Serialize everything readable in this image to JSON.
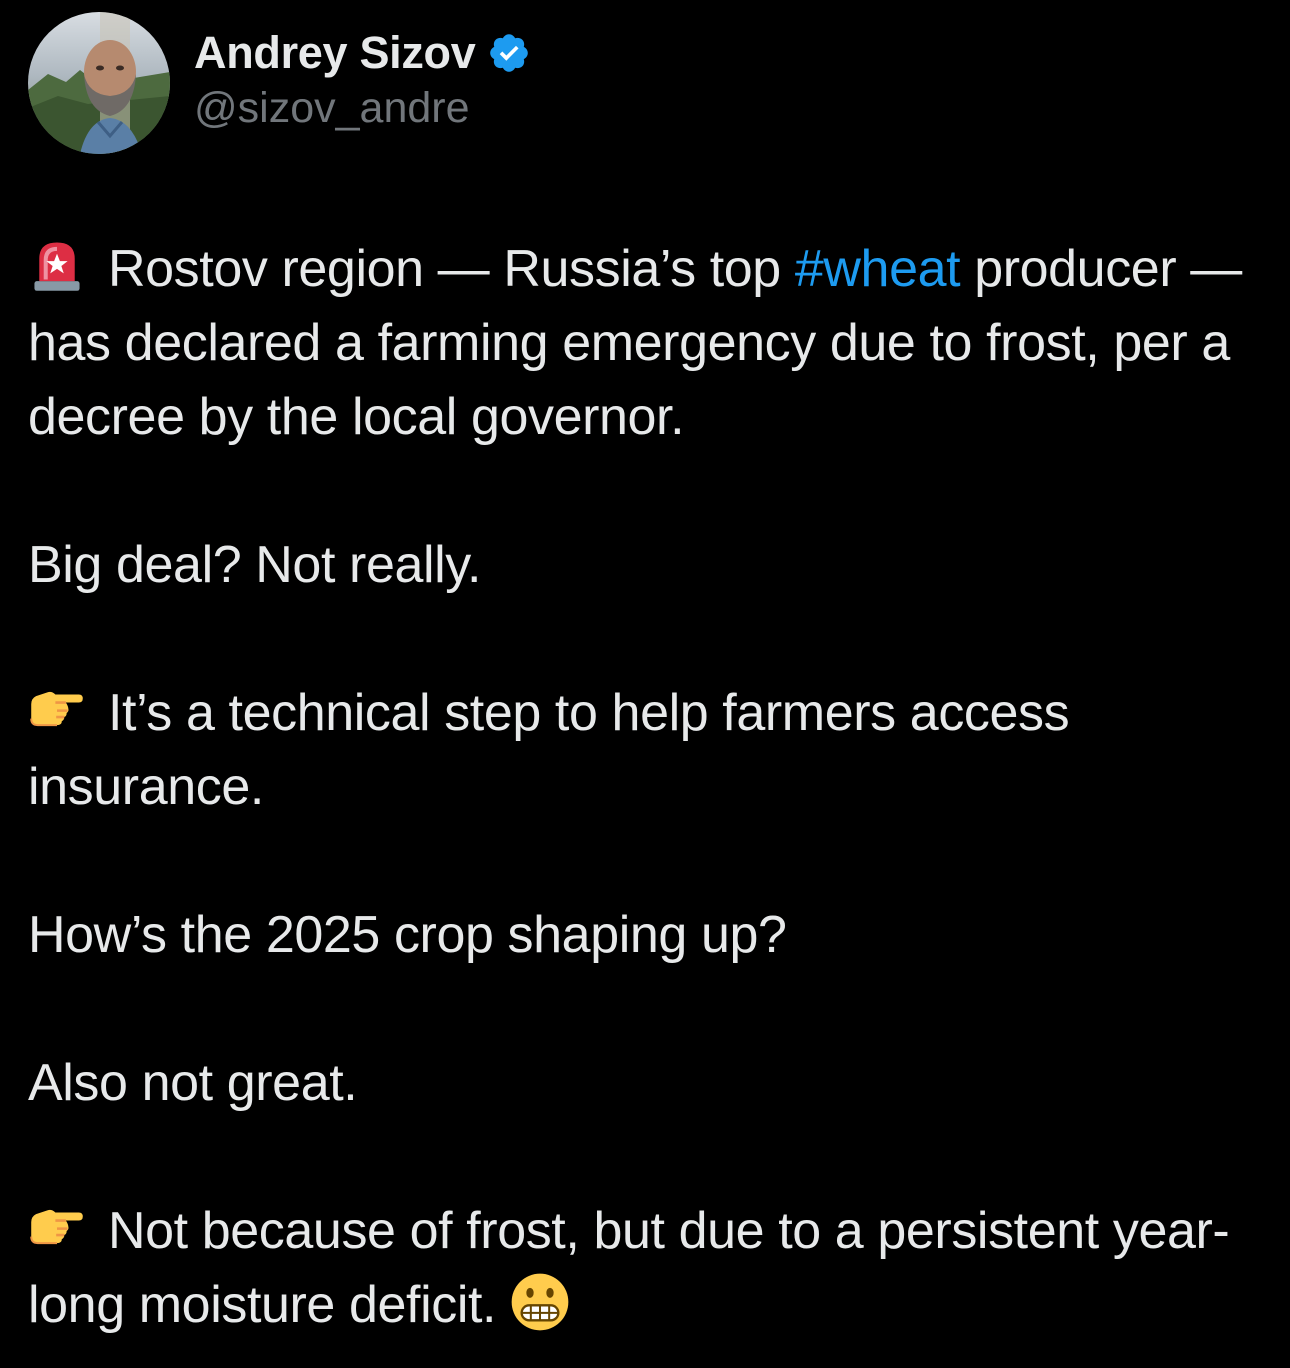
{
  "author": {
    "display_name": "Andrey Sizov",
    "handle": "@sizov_andre",
    "verified": true,
    "verified_color": "#1d9bf0"
  },
  "tweet": {
    "p1": {
      "icon": "rotating-light-icon",
      "before_hashtag": "Rostov region — Russia’s top ",
      "hashtag": "#wheat",
      "after_hashtag": " producer — has declared a farming emergency due to frost, per a decree by the local governor."
    },
    "p2": "Big deal? Not really.",
    "p3": {
      "icon": "pointing-right-icon",
      "text": "It’s a technical step to help farmers access insurance."
    },
    "p4": "How’s the 2025 crop shaping up?",
    "p5": "Also not great.",
    "p6": {
      "icon": "pointing-right-icon",
      "text": "Not because of frost, but due to a persistent year-long moisture deficit.",
      "trailing_icon": "grimacing-face-icon"
    }
  },
  "colors": {
    "background": "#000000",
    "text": "#e7e9ea",
    "secondary_text": "#71767b",
    "link": "#1d9bf0"
  }
}
